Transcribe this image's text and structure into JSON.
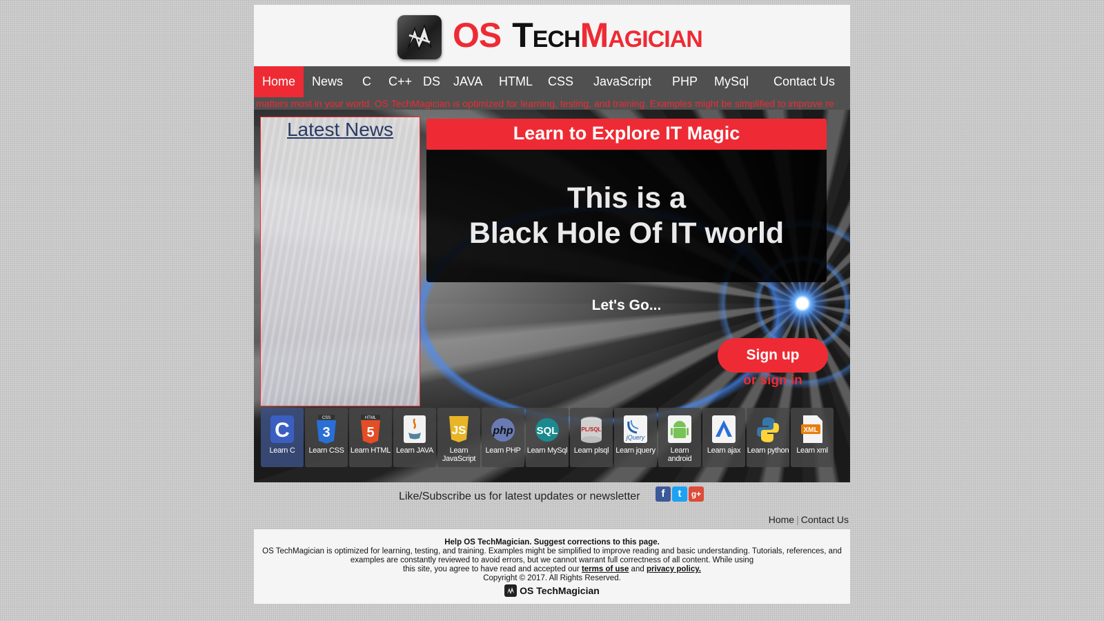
{
  "header": {
    "logo_os": "OS",
    "logo_tech_first": "T",
    "logo_tech_rest": "ECH",
    "logo_magic_first": "M",
    "logo_magic_rest": "AGICIAN"
  },
  "nav": {
    "items": [
      "Home",
      "News",
      "C",
      "C++",
      "DS",
      "JAVA",
      "HTML",
      "CSS",
      "JavaScript",
      "PHP",
      "MySql",
      "Contact Us"
    ],
    "active": "Home"
  },
  "ticker": "matters most in your world. OS TechMagician is optimized for learning, testing, and training. Examples might be simplified to improve re",
  "news_panel": {
    "title": "Latest News"
  },
  "hero": {
    "banner": "Learn to Explore IT Magic",
    "headline_line1": "This is a",
    "headline_line2": "Black Hole Of IT world",
    "cta_text": "Let's Go...",
    "signup_label": "Sign up",
    "signin_label": "or sign in"
  },
  "tiles": [
    {
      "label": "Learn C",
      "icon": "c-icon"
    },
    {
      "label": "Learn CSS",
      "icon": "css3-icon"
    },
    {
      "label": "Learn HTML",
      "icon": "html5-icon"
    },
    {
      "label": "Learn JAVA",
      "icon": "java-icon"
    },
    {
      "label": "Learn JavaScript",
      "icon": "javascript-icon"
    },
    {
      "label": "Learn PHP",
      "icon": "php-icon"
    },
    {
      "label": "Learn MySql",
      "icon": "sql-icon"
    },
    {
      "label": "Learn plsql",
      "icon": "plsql-icon"
    },
    {
      "label": "Learn jquery",
      "icon": "jquery-icon"
    },
    {
      "label": "Learn android",
      "icon": "android-icon"
    },
    {
      "label": "Learn ajax",
      "icon": "ajax-icon"
    },
    {
      "label": "Learn python",
      "icon": "python-icon"
    },
    {
      "label": "Learn xml",
      "icon": "xml-icon"
    }
  ],
  "tile_icon_text": {
    "c": "C",
    "css_top": "CSS",
    "css": "3",
    "html_top": "HTML",
    "html": "5",
    "js": "JS",
    "php": "php",
    "sql": "SQL",
    "plsql": "PL/SQL",
    "jquery": "jQuery",
    "xml": "XML"
  },
  "subscribe": {
    "text": "Like/Subscribe us for latest updates or newsletter",
    "facebook": "f",
    "twitter": "t",
    "googleplus": "g+"
  },
  "footer_links": {
    "home": "Home",
    "contact": "Contact Us"
  },
  "footer": {
    "heading": "Help OS TechMagician. Suggest corrections to this page.",
    "line1": "OS TechMagician is optimized for learning, testing, and training. Examples might be simplified to improve reading and basic understanding. Tutorials, references, and",
    "line2": "examples are constantly reviewed to avoid errors, but we cannot warrant full correctness of all content. While using",
    "line3_pre": "this site, you agree to have read and accepted our",
    "terms": "terms of use",
    "and": "and",
    "privacy": "privacy policy.",
    "copyright": "Copyright © 2017. All Rights Reserved.",
    "brand": "OS TechMagician"
  },
  "colors": {
    "accent": "#ee2b34",
    "nav_bg": "#505050",
    "header_bg": "#f5f5f5"
  }
}
